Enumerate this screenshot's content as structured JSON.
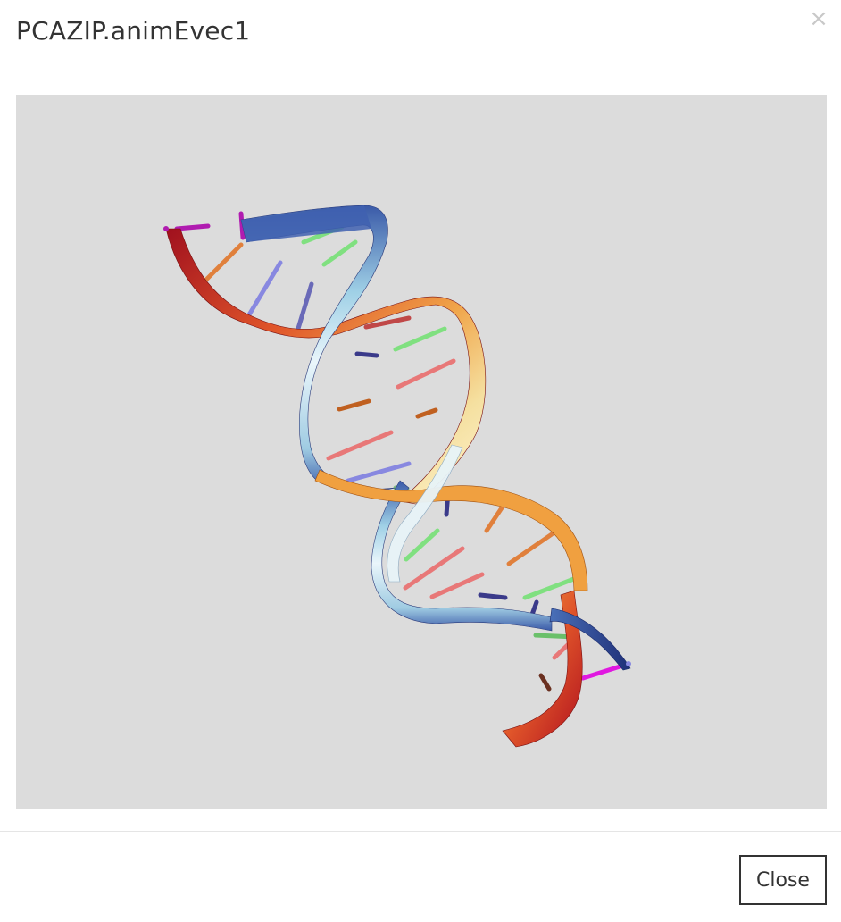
{
  "dialog": {
    "title": "PCAZIP.animEvec1",
    "close_icon": "close-icon",
    "close_glyph": "×",
    "close_button_label": "Close"
  },
  "viewer": {
    "background": "#dcdcdc",
    "content": "dna-double-helix-3d",
    "strand_colors": [
      "#b0101e",
      "#e0552a",
      "#f0a54a",
      "#f5e0a0",
      "#cfe8f2",
      "#3a5aa8",
      "#2a3a8a"
    ],
    "base_colors": [
      "#e87878",
      "#80e080",
      "#8888e0",
      "#e0803c",
      "#b01cb0",
      "#6a3020"
    ]
  }
}
